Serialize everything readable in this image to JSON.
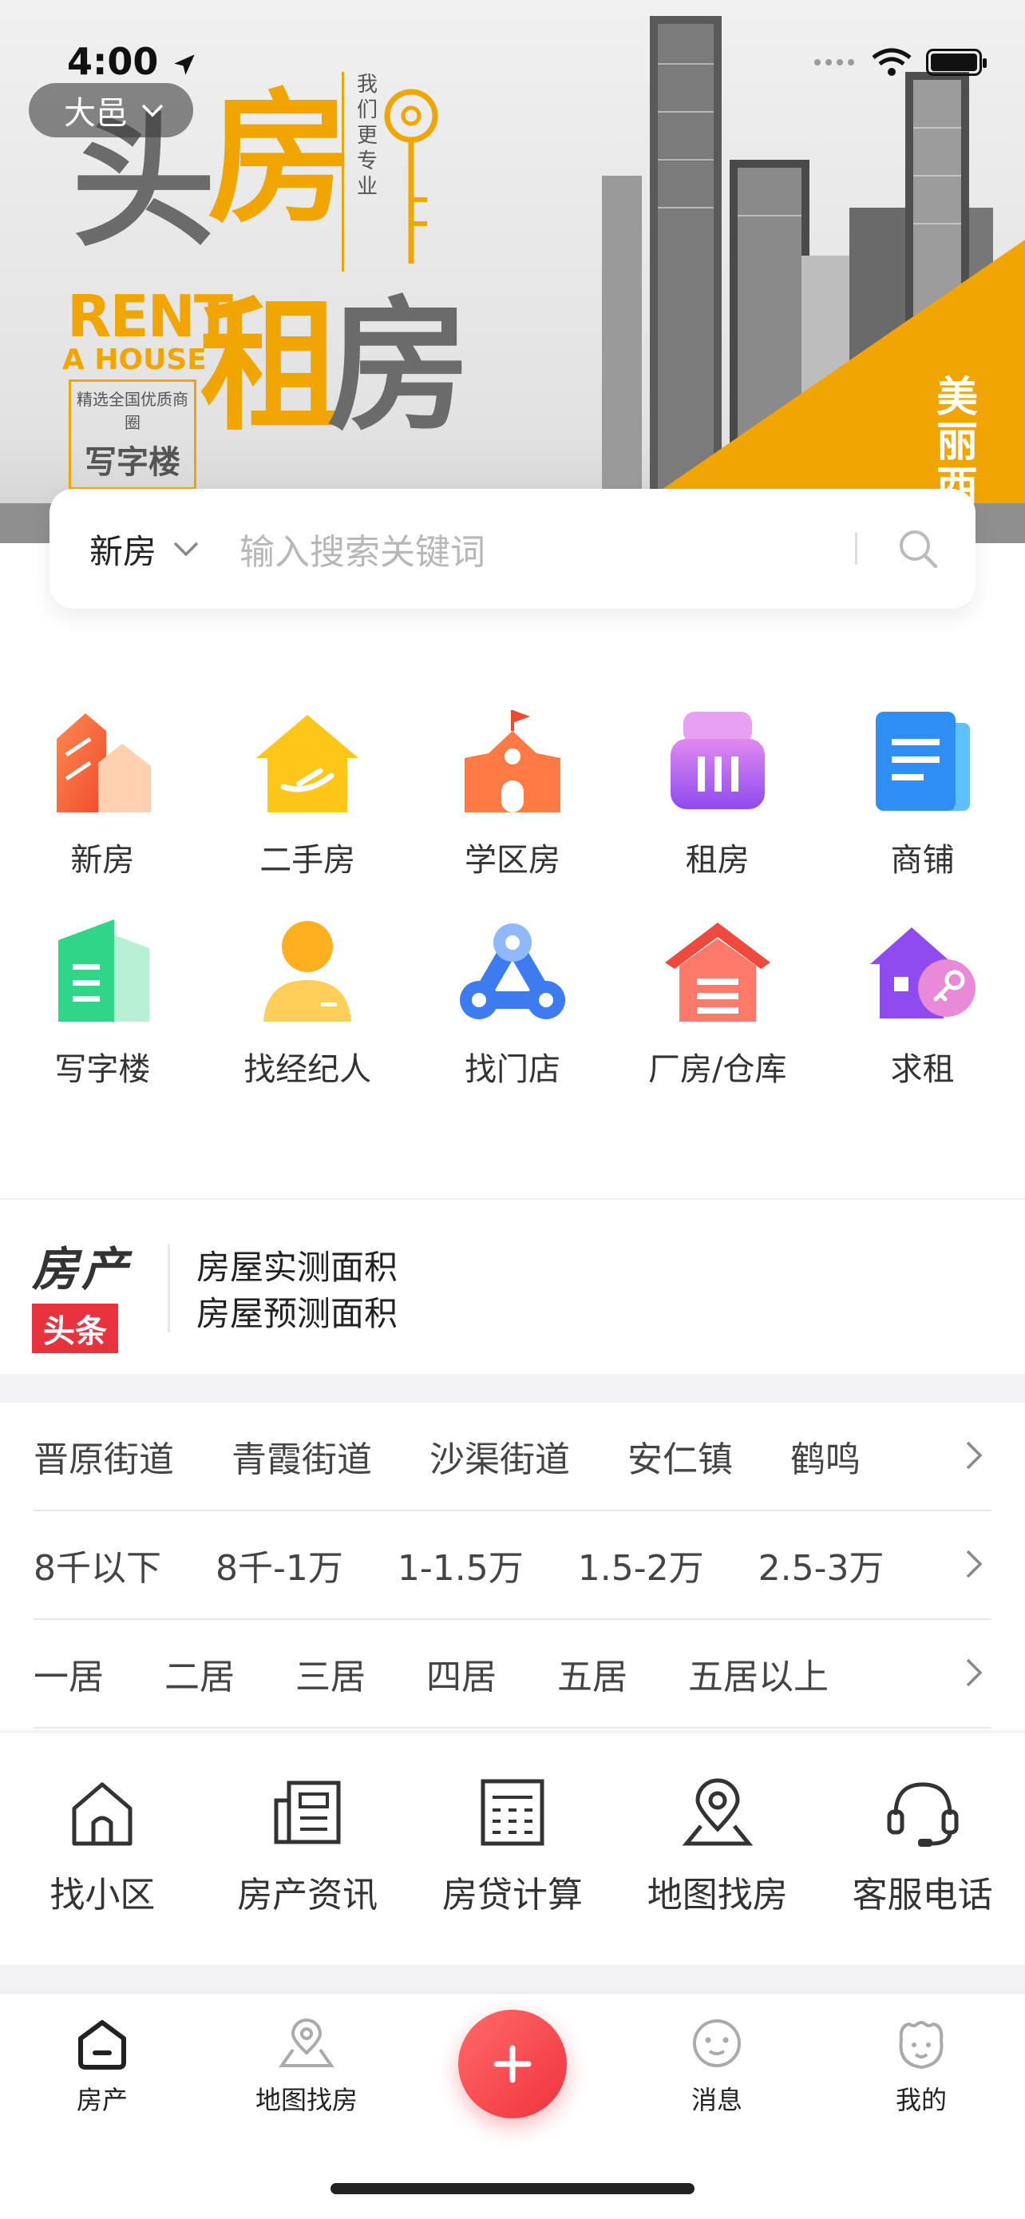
{
  "status_bar": {
    "time": "4:00"
  },
  "city_selector": {
    "label": "大邑"
  },
  "banner": {
    "title_line1_a": "头",
    "title_line1_b": "房",
    "title_line2_a": "租",
    "title_line2_b": "房",
    "slogan": "我们更专业",
    "rent": "RENT",
    "a_house": "A HOUSE",
    "small_desc": "精选全国优质商圈",
    "small_big": "写字楼",
    "corner_text": "美丽西岭"
  },
  "search": {
    "type": "新房",
    "placeholder": "输入搜索关键词"
  },
  "categories": [
    {
      "label": "新房",
      "icon": "new-house-icon"
    },
    {
      "label": "二手房",
      "icon": "second-hand-house-icon"
    },
    {
      "label": "学区房",
      "icon": "school-district-icon"
    },
    {
      "label": "租房",
      "icon": "rent-icon"
    },
    {
      "label": "商铺",
      "icon": "shop-icon"
    },
    {
      "label": "写字楼",
      "icon": "office-building-icon"
    },
    {
      "label": "找经纪人",
      "icon": "agent-icon"
    },
    {
      "label": "找门店",
      "icon": "store-icon"
    },
    {
      "label": "厂房/仓库",
      "icon": "warehouse-icon"
    },
    {
      "label": "求租",
      "icon": "seek-rent-icon"
    }
  ],
  "headline": {
    "logo_top": "房产",
    "logo_bottom": "头条",
    "items": [
      "房屋实测面积",
      "房屋预测面积"
    ]
  },
  "filters": {
    "areas": [
      "晋原街道",
      "青霞街道",
      "沙渠街道",
      "安仁镇",
      "鹤鸣"
    ],
    "prices": [
      "8千以下",
      "8千-1万",
      "1-1.5万",
      "1.5-2万",
      "2.5-3万"
    ],
    "rooms": [
      "一居",
      "二居",
      "三居",
      "四居",
      "五居",
      "五居以上"
    ]
  },
  "tools": [
    {
      "label": "找小区",
      "icon": "house-outline-icon"
    },
    {
      "label": "房产资讯",
      "icon": "news-icon"
    },
    {
      "label": "房贷计算",
      "icon": "calculator-icon"
    },
    {
      "label": "地图找房",
      "icon": "map-pin-icon"
    },
    {
      "label": "客服电话",
      "icon": "headset-icon"
    }
  ],
  "tabbar": {
    "home": "房产",
    "map": "地图找房",
    "messages": "消息",
    "mine": "我的"
  },
  "colors": {
    "accent": "#f0a500",
    "brand_red": "#f0333e"
  }
}
